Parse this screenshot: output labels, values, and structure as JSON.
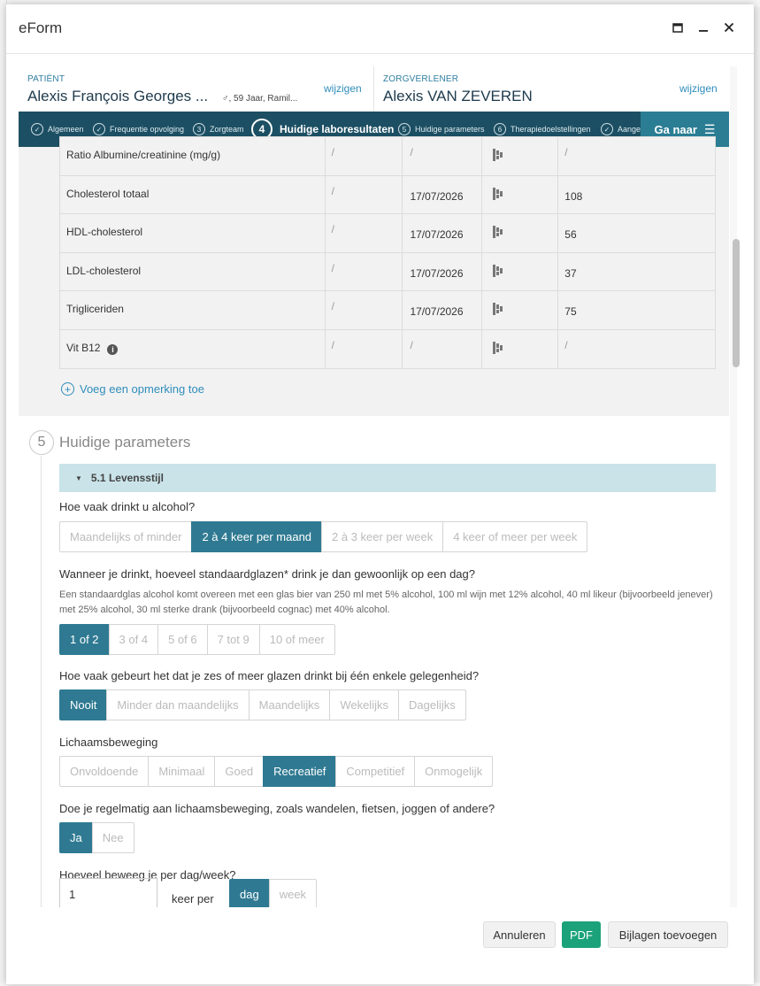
{
  "modal": {
    "title": "eForm"
  },
  "patient": {
    "label": "PATIËNT",
    "name": "Alexis François Georges ...",
    "meta": "♂, 59 Jaar, Ramil...",
    "change": "wijzigen"
  },
  "caregiver": {
    "label": "ZORGVERLENER",
    "name": "Alexis VAN ZEVEREN",
    "change": "wijzigen"
  },
  "steps": [
    {
      "num": "✓",
      "label": "Algemeen"
    },
    {
      "num": "✓",
      "label": "Frequentie opvolging"
    },
    {
      "num": "3",
      "label": "Zorgteam"
    },
    {
      "num": "4",
      "label": "Huidige laboresultaten"
    },
    {
      "num": "5",
      "label": "Huidige parameters"
    },
    {
      "num": "6",
      "label": "Therapiedoelstellingen"
    },
    {
      "num": "✓",
      "label": "Aange"
    }
  ],
  "goto": {
    "label": "Ga naar",
    "icon": "menu-icon"
  },
  "lab_rows": [
    {
      "name": "Ratio Albumine/creatinine (mg/g)",
      "status": "/",
      "date": "/",
      "value": "/"
    },
    {
      "name": "Cholesterol totaal",
      "status": "/",
      "date": "17/07/2026",
      "value": "108"
    },
    {
      "name": "HDL-cholesterol",
      "status": "/",
      "date": "17/07/2026",
      "value": "56"
    },
    {
      "name": "LDL-cholesterol",
      "status": "/",
      "date": "17/07/2026",
      "value": "37"
    },
    {
      "name": "Trigliceriden",
      "status": "/",
      "date": "17/07/2026",
      "value": "75"
    },
    {
      "name": "Vit B12",
      "status": "/",
      "date": "/",
      "value": "/",
      "info": "i"
    }
  ],
  "add_remark": {
    "label": "Voeg een opmerking toe",
    "icon": "plus-circle-icon"
  },
  "section5": {
    "num": "5",
    "title": "Huidige parameters"
  },
  "subsection": {
    "title": "5.1 Levensstijl"
  },
  "q_alcohol_freq": {
    "question": "Hoe vaak drinkt u alcohol?",
    "options": [
      "Maandelijks of minder",
      "2 à 4 keer per maand",
      "2 à 3 keer per week",
      "4 keer of meer per week"
    ],
    "selected": 1
  },
  "q_glasses": {
    "question": "Wanneer je drinkt, hoeveel standaardglazen* drink je dan gewoonlijk op een dag?",
    "help": "Een standaardglas alcohol komt overeen met een glas bier van 250 ml met 5% alcohol, 100 ml wijn met 12% alcohol, 40 ml likeur (bijvoorbeeld jenever) met 25% alcohol, 30 ml sterke drank (bijvoorbeeld cognac) met 40% alcohol.",
    "options": [
      "1 of 2",
      "3 of 4",
      "5 of 6",
      "7 tot 9",
      "10 of meer"
    ],
    "selected": 0
  },
  "q_binge": {
    "question": "Hoe vaak gebeurt het dat je zes of meer glazen drinkt bij één enkele gelegenheid?",
    "options": [
      "Nooit",
      "Minder dan maandelijks",
      "Maandelijks",
      "Wekelijks",
      "Dagelijks"
    ],
    "selected": 0
  },
  "q_exercise": {
    "question": "Lichaamsbeweging",
    "options": [
      "Onvoldoende",
      "Minimaal",
      "Goed",
      "Recreatief",
      "Competitief",
      "Onmogelijk"
    ],
    "selected": 3
  },
  "q_regular": {
    "question": "Doe je regelmatig aan lichaamsbeweging, zoals wandelen, fietsen, joggen of andere?",
    "options": [
      "Ja",
      "Nee"
    ],
    "selected": 0
  },
  "q_how_often": {
    "question": "Hoeveel beweeg je per dag/week?",
    "value": "1",
    "mid_label": "keer per",
    "options": [
      "dag",
      "week"
    ],
    "selected": 0
  },
  "footer": {
    "cancel": "Annuleren",
    "pdf": "PDF",
    "attach": "Bijlagen toevoegen"
  },
  "colors": {
    "primary_dark": "#1c4f63",
    "selected": "#2f7a92",
    "pdf_green": "#1ba27a",
    "link": "#2f8dbb"
  }
}
